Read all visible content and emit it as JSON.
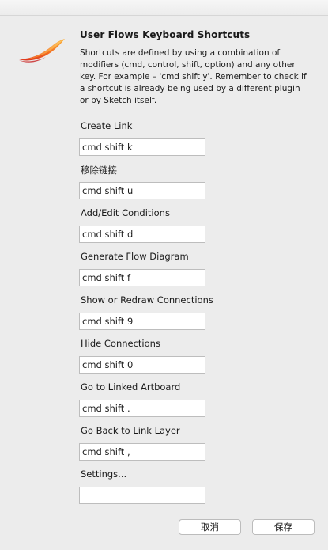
{
  "dialog": {
    "title": "User Flows Keyboard Shortcuts",
    "description": "Shortcuts are defined by using a combination of modifiers (cmd, control, shift, option) and any other key. For example – 'cmd shift y'. Remember to check if a shortcut is already being used by a different plugin or by Sketch itself.",
    "icon": "sketch-plugin-brush-icon"
  },
  "shortcuts": [
    {
      "label": "Create Link",
      "value": "cmd shift k"
    },
    {
      "label": "移除链接",
      "value": "cmd shift u"
    },
    {
      "label": "Add/Edit Conditions",
      "value": "cmd shift d"
    },
    {
      "label": "Generate Flow Diagram",
      "value": "cmd shift f"
    },
    {
      "label": "Show or Redraw Connections",
      "value": "cmd shift 9"
    },
    {
      "label": "Hide Connections",
      "value": "cmd shift 0"
    },
    {
      "label": "Go to Linked Artboard",
      "value": "cmd shift ."
    },
    {
      "label": "Go Back to Link Layer",
      "value": "cmd shift ,"
    },
    {
      "label": "Settings...",
      "value": ""
    }
  ],
  "buttons": {
    "cancel": "取消",
    "save": "保存"
  },
  "colors": {
    "background": "#ececec",
    "field_border": "#bdbdbd",
    "logo_orange": "#f5821f",
    "logo_red": "#e8412c"
  }
}
